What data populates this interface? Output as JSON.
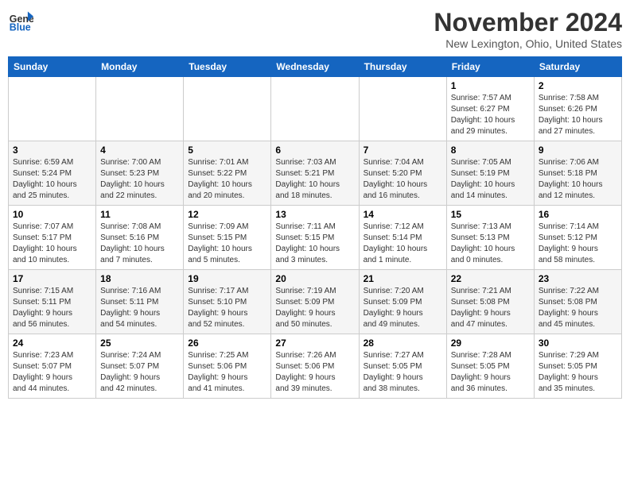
{
  "header": {
    "logo_line1": "General",
    "logo_line2": "Blue",
    "month_title": "November 2024",
    "location": "New Lexington, Ohio, United States"
  },
  "days_of_week": [
    "Sunday",
    "Monday",
    "Tuesday",
    "Wednesday",
    "Thursday",
    "Friday",
    "Saturday"
  ],
  "weeks": [
    [
      {
        "day": "",
        "info": ""
      },
      {
        "day": "",
        "info": ""
      },
      {
        "day": "",
        "info": ""
      },
      {
        "day": "",
        "info": ""
      },
      {
        "day": "",
        "info": ""
      },
      {
        "day": "1",
        "info": "Sunrise: 7:57 AM\nSunset: 6:27 PM\nDaylight: 10 hours\nand 29 minutes."
      },
      {
        "day": "2",
        "info": "Sunrise: 7:58 AM\nSunset: 6:26 PM\nDaylight: 10 hours\nand 27 minutes."
      }
    ],
    [
      {
        "day": "3",
        "info": "Sunrise: 6:59 AM\nSunset: 5:24 PM\nDaylight: 10 hours\nand 25 minutes."
      },
      {
        "day": "4",
        "info": "Sunrise: 7:00 AM\nSunset: 5:23 PM\nDaylight: 10 hours\nand 22 minutes."
      },
      {
        "day": "5",
        "info": "Sunrise: 7:01 AM\nSunset: 5:22 PM\nDaylight: 10 hours\nand 20 minutes."
      },
      {
        "day": "6",
        "info": "Sunrise: 7:03 AM\nSunset: 5:21 PM\nDaylight: 10 hours\nand 18 minutes."
      },
      {
        "day": "7",
        "info": "Sunrise: 7:04 AM\nSunset: 5:20 PM\nDaylight: 10 hours\nand 16 minutes."
      },
      {
        "day": "8",
        "info": "Sunrise: 7:05 AM\nSunset: 5:19 PM\nDaylight: 10 hours\nand 14 minutes."
      },
      {
        "day": "9",
        "info": "Sunrise: 7:06 AM\nSunset: 5:18 PM\nDaylight: 10 hours\nand 12 minutes."
      }
    ],
    [
      {
        "day": "10",
        "info": "Sunrise: 7:07 AM\nSunset: 5:17 PM\nDaylight: 10 hours\nand 10 minutes."
      },
      {
        "day": "11",
        "info": "Sunrise: 7:08 AM\nSunset: 5:16 PM\nDaylight: 10 hours\nand 7 minutes."
      },
      {
        "day": "12",
        "info": "Sunrise: 7:09 AM\nSunset: 5:15 PM\nDaylight: 10 hours\nand 5 minutes."
      },
      {
        "day": "13",
        "info": "Sunrise: 7:11 AM\nSunset: 5:15 PM\nDaylight: 10 hours\nand 3 minutes."
      },
      {
        "day": "14",
        "info": "Sunrise: 7:12 AM\nSunset: 5:14 PM\nDaylight: 10 hours\nand 1 minute."
      },
      {
        "day": "15",
        "info": "Sunrise: 7:13 AM\nSunset: 5:13 PM\nDaylight: 10 hours\nand 0 minutes."
      },
      {
        "day": "16",
        "info": "Sunrise: 7:14 AM\nSunset: 5:12 PM\nDaylight: 9 hours\nand 58 minutes."
      }
    ],
    [
      {
        "day": "17",
        "info": "Sunrise: 7:15 AM\nSunset: 5:11 PM\nDaylight: 9 hours\nand 56 minutes."
      },
      {
        "day": "18",
        "info": "Sunrise: 7:16 AM\nSunset: 5:11 PM\nDaylight: 9 hours\nand 54 minutes."
      },
      {
        "day": "19",
        "info": "Sunrise: 7:17 AM\nSunset: 5:10 PM\nDaylight: 9 hours\nand 52 minutes."
      },
      {
        "day": "20",
        "info": "Sunrise: 7:19 AM\nSunset: 5:09 PM\nDaylight: 9 hours\nand 50 minutes."
      },
      {
        "day": "21",
        "info": "Sunrise: 7:20 AM\nSunset: 5:09 PM\nDaylight: 9 hours\nand 49 minutes."
      },
      {
        "day": "22",
        "info": "Sunrise: 7:21 AM\nSunset: 5:08 PM\nDaylight: 9 hours\nand 47 minutes."
      },
      {
        "day": "23",
        "info": "Sunrise: 7:22 AM\nSunset: 5:08 PM\nDaylight: 9 hours\nand 45 minutes."
      }
    ],
    [
      {
        "day": "24",
        "info": "Sunrise: 7:23 AM\nSunset: 5:07 PM\nDaylight: 9 hours\nand 44 minutes."
      },
      {
        "day": "25",
        "info": "Sunrise: 7:24 AM\nSunset: 5:07 PM\nDaylight: 9 hours\nand 42 minutes."
      },
      {
        "day": "26",
        "info": "Sunrise: 7:25 AM\nSunset: 5:06 PM\nDaylight: 9 hours\nand 41 minutes."
      },
      {
        "day": "27",
        "info": "Sunrise: 7:26 AM\nSunset: 5:06 PM\nDaylight: 9 hours\nand 39 minutes."
      },
      {
        "day": "28",
        "info": "Sunrise: 7:27 AM\nSunset: 5:05 PM\nDaylight: 9 hours\nand 38 minutes."
      },
      {
        "day": "29",
        "info": "Sunrise: 7:28 AM\nSunset: 5:05 PM\nDaylight: 9 hours\nand 36 minutes."
      },
      {
        "day": "30",
        "info": "Sunrise: 7:29 AM\nSunset: 5:05 PM\nDaylight: 9 hours\nand 35 minutes."
      }
    ]
  ]
}
